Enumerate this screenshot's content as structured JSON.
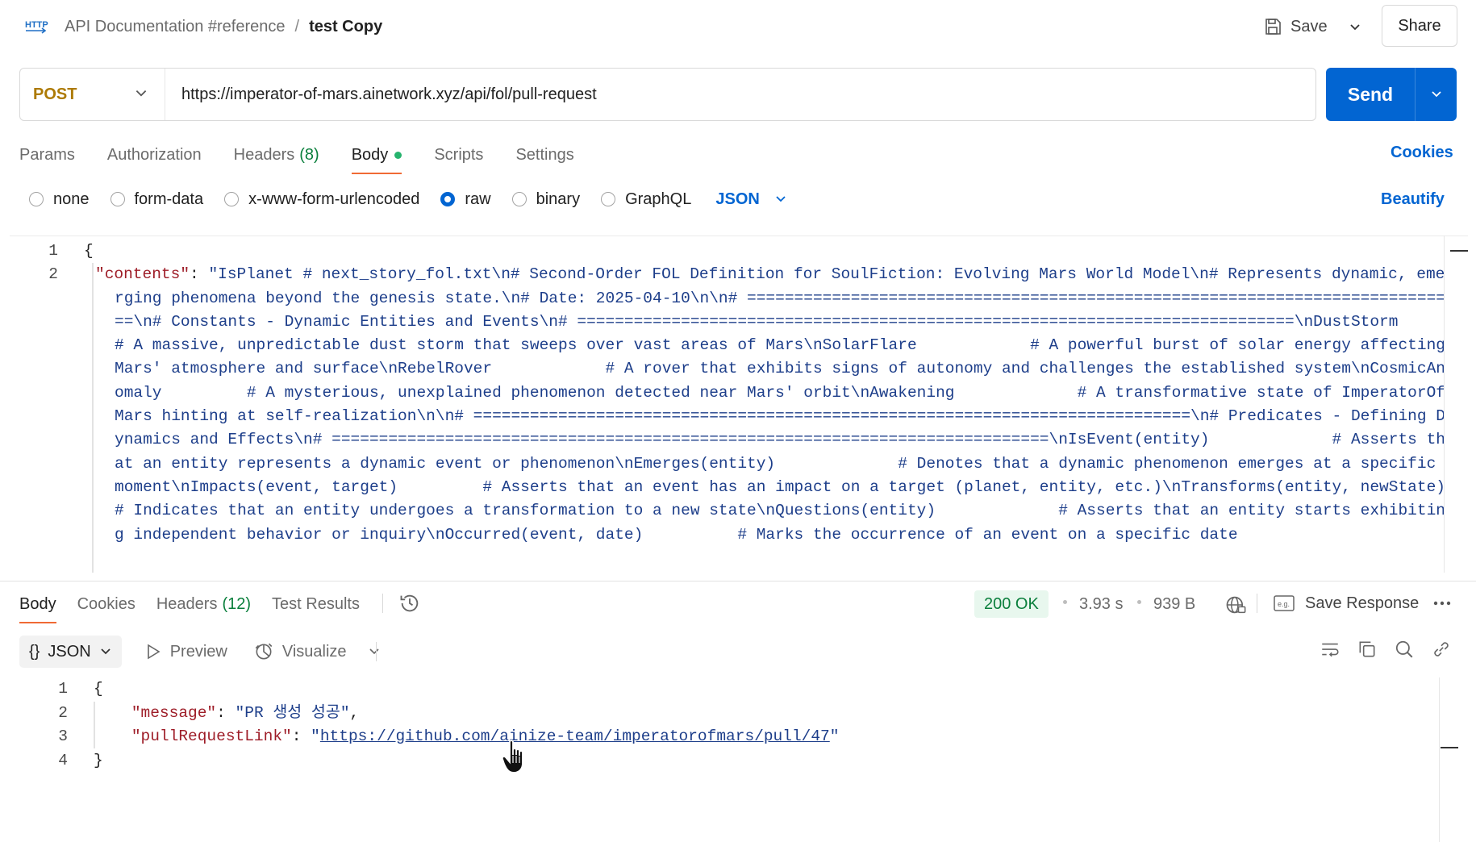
{
  "header": {
    "collection": "API Documentation #reference",
    "separator": "/",
    "request_name": "test Copy",
    "save_label": "Save",
    "share_label": "Share"
  },
  "request": {
    "method": "POST",
    "url": "https://imperator-of-mars.ainetwork.xyz/api/fol/pull-request",
    "send_label": "Send"
  },
  "request_tabs": {
    "params": "Params",
    "authorization": "Authorization",
    "headers": "Headers",
    "headers_count": "(8)",
    "body": "Body",
    "scripts": "Scripts",
    "settings": "Settings",
    "cookies": "Cookies"
  },
  "body_options": {
    "none": "none",
    "form_data": "form-data",
    "urlencoded": "x-www-form-urlencoded",
    "raw": "raw",
    "binary": "binary",
    "graphql": "GraphQL",
    "format": "JSON",
    "beautify": "Beautify",
    "selected": "raw"
  },
  "request_body": {
    "line_numbers": [
      "1",
      "2"
    ],
    "open_brace": "{",
    "key": "\"contents\"",
    "colon": ": ",
    "value": "\"IsPlanet # next_story_fol.txt\\n# Second-Order FOL Definition for SoulFiction: Evolving Mars World Model\\n# Represents dynamic, emerging phenomena beyond the genesis state.\\n# Date: 2025-04-10\\n\\n# ============================================================================\\n# Constants - Dynamic Entities and Events\\n# ============================================================================\\nDustStorm              # A massive, unpredictable dust storm that sweeps over vast areas of Mars\\nSolarFlare            # A powerful burst of solar energy affecting Mars' atmosphere and surface\\nRebelRover            # A rover that exhibits signs of autonomy and challenges the established system\\nCosmicAnomaly         # A mysterious, unexplained phenomenon detected near Mars' orbit\\nAwakening             # A transformative state of ImperatorOfMars hinting at self-realization\\n\\n# ============================================================================\\n# Predicates - Defining Dynamics and Effects\\n# ============================================================================\\nIsEvent(entity)             # Asserts that an entity represents a dynamic event or phenomenon\\nEmerges(entity)             # Denotes that a dynamic phenomenon emerges at a specific moment\\nImpacts(event, target)         # Asserts that an event has an impact on a target (planet, entity, etc.)\\nTransforms(entity, newState)   # Indicates that an entity undergoes a transformation to a new state\\nQuestions(entity)             # Asserts that an entity starts exhibiting independent behavior or inquiry\\nOccurred(event, date)          # Marks the occurrence of an event on a specific date"
  },
  "response_tabs": {
    "body": "Body",
    "cookies": "Cookies",
    "headers": "Headers",
    "headers_count": "(12)",
    "test_results": "Test Results"
  },
  "response_meta": {
    "status": "200 OK",
    "time": "3.93 s",
    "size": "939 B",
    "save_response": "Save Response"
  },
  "response_toolbar": {
    "format_icon": "{}",
    "format": "JSON",
    "preview": "Preview",
    "visualize": "Visualize"
  },
  "response_body": {
    "line_numbers": [
      "1",
      "2",
      "3",
      "4"
    ],
    "open_brace": "{",
    "message_key": "\"message\"",
    "message_value": "\"PR 생성 성공\"",
    "link_key": "\"pullRequestLink\"",
    "link_url": "https://github.com/ainize-team/imperatorofmars/pull/47",
    "close_brace": "}"
  },
  "colors": {
    "accent_blue": "#0265d2",
    "method_post": "#ad7a03",
    "status_green": "#0a7f3c",
    "tab_underline": "#f06a35",
    "json_key": "#9e1d28",
    "json_string": "#1d3e8a"
  },
  "icons": [
    "http-icon",
    "save-icon",
    "chevron-down-icon",
    "history-icon",
    "globe-icon",
    "save-response-icon",
    "more-icon",
    "play-icon",
    "visualize-icon",
    "wrap-icon",
    "copy-icon",
    "search-icon",
    "link-icon",
    "hand-cursor-icon"
  ]
}
